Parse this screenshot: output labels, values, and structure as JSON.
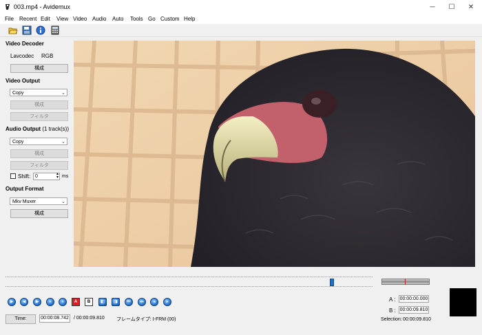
{
  "window": {
    "title": "003.mp4 - Avidemux",
    "minimize": "─",
    "maximize": "☐",
    "close": "✕"
  },
  "menu": [
    "File",
    "Recent",
    "Edit",
    "View",
    "Video",
    "Audio",
    "Auto",
    "Tools",
    "Go",
    "Custom",
    "Help"
  ],
  "toolbar": {
    "icons": [
      "open-icon",
      "save-icon",
      "info-icon",
      "calculator-icon"
    ]
  },
  "video_decoder": {
    "heading": "Video Decoder",
    "codec": "Lavcodec",
    "format": "RGB",
    "configure": "構成"
  },
  "video_output": {
    "heading": "Video Output",
    "codec": "Copy",
    "configure": "構成",
    "filters": "フィルタ"
  },
  "audio_output": {
    "heading": "Audio Output",
    "tracks": "(1 track(s))",
    "codec": "Copy",
    "configure": "構成",
    "filters": "フィルタ",
    "shift_label": "Shift:",
    "shift_value": "0",
    "shift_unit": "ms"
  },
  "output_format": {
    "heading": "Output Format",
    "muxer": "Mkv Muxer",
    "configure": "構成"
  },
  "navigation": {
    "icons": [
      "play-icon",
      "rewind-icon",
      "forward-icon",
      "prev-frame-icon",
      "next-frame-icon",
      "set-marker-a-icon",
      "set-marker-b-icon",
      "prev-black-icon",
      "next-black-icon",
      "first-frame-icon",
      "last-frame-icon",
      "prev-keyframe-icon",
      "next-keyframe-icon"
    ],
    "marker_a_text": "A",
    "marker_b_text": "B"
  },
  "status": {
    "time_button": "Time:",
    "current_time": "00:00:08.742",
    "total_time": "/ 00:00:09.810",
    "frame_type": "フレームタイプ: I-FRM (00)"
  },
  "selection": {
    "a_label": "A :",
    "a_time": "00:00:00.000",
    "b_label": "B :",
    "b_time": "00:00:09.810",
    "selection_label": "Selection:",
    "selection_time": "00:00:09.810"
  },
  "slider": {
    "position_fraction": 0.89
  },
  "colors": {
    "accent": "#1e6fd0",
    "video_bg": "#e8c9a1"
  }
}
